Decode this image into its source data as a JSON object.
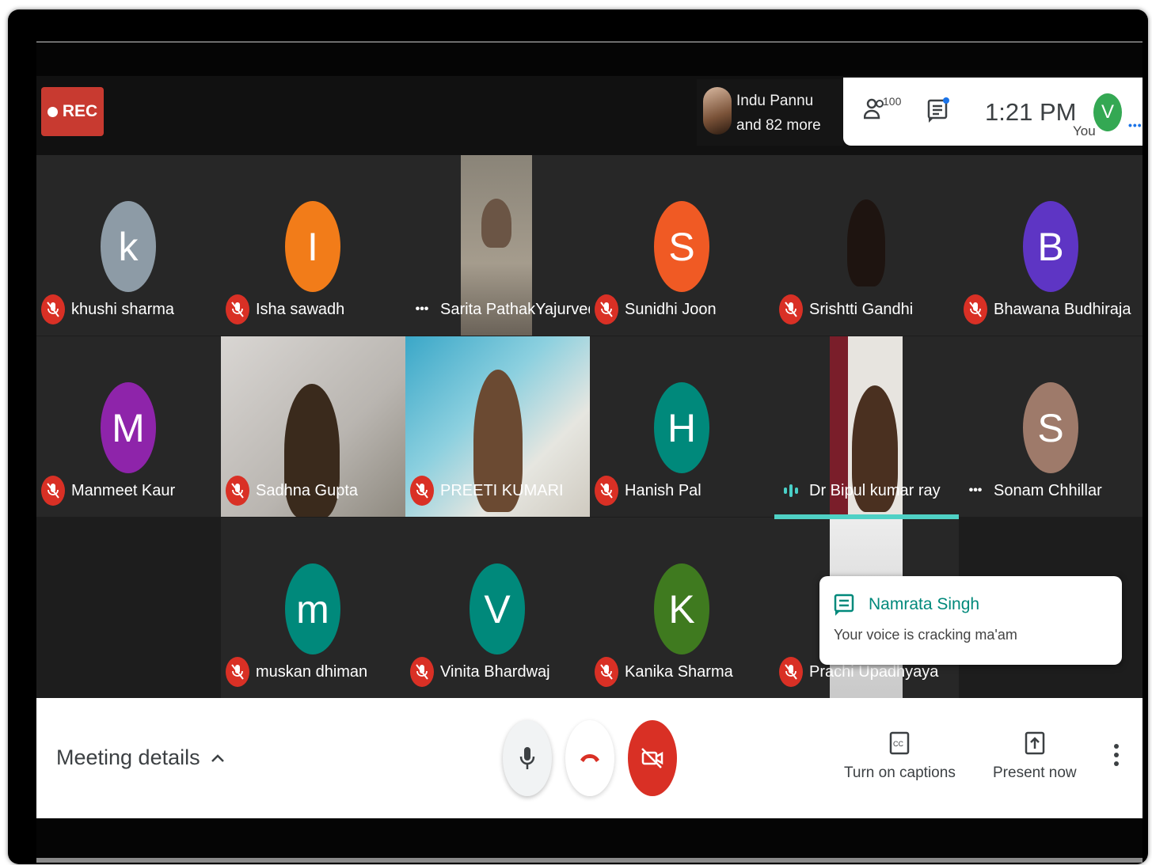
{
  "recording": {
    "label": "REC"
  },
  "host": {
    "line1": "Indu Pannu",
    "line2": "and 82 more"
  },
  "header": {
    "participant_count": "100",
    "time": "1:21 PM",
    "user_initial": "V",
    "user_label": "You"
  },
  "participants": [
    {
      "name": "khushi sharma",
      "initial": "k",
      "color": "#8d9ba6",
      "status": "muted"
    },
    {
      "name": "Isha sawadh",
      "initial": "I",
      "color": "#f27c19",
      "status": "muted"
    },
    {
      "name": "Sarita PathakYajurvedi",
      "initial": "",
      "color": "",
      "status": "more"
    },
    {
      "name": "Sunidhi Joon",
      "initial": "S",
      "color": "#f05a24",
      "status": "muted"
    },
    {
      "name": "Srishtti Gandhi",
      "initial": "",
      "color": "",
      "status": "muted"
    },
    {
      "name": "Bhawana Budhiraja",
      "initial": "B",
      "color": "#5e35c4",
      "status": "muted"
    },
    {
      "name": "Manmeet Kaur",
      "initial": "M",
      "color": "#8e24aa",
      "status": "muted"
    },
    {
      "name": "Sadhna Gupta",
      "initial": "",
      "color": "",
      "status": "muted"
    },
    {
      "name": "PREETI KUMARI",
      "initial": "",
      "color": "",
      "status": "muted"
    },
    {
      "name": "Hanish Pal",
      "initial": "H",
      "color": "#00897b",
      "status": "muted"
    },
    {
      "name": "Dr Bipul kumar ray",
      "initial": "",
      "color": "",
      "status": "speaking"
    },
    {
      "name": "Sonam Chhillar",
      "initial": "S",
      "color": "#9e7a6a",
      "status": "more"
    },
    {
      "name": "muskan dhiman",
      "initial": "m",
      "color": "#00897b",
      "status": "muted"
    },
    {
      "name": "Vinita Bhardwaj",
      "initial": "V",
      "color": "#00897b",
      "status": "muted"
    },
    {
      "name": "Kanika Sharma",
      "initial": "K",
      "color": "#3f7a1f",
      "status": "muted"
    },
    {
      "name": "Prachi Upadhyaya",
      "initial": "",
      "color": "",
      "status": "muted"
    }
  ],
  "chat_notification": {
    "sender": "Namrata Singh",
    "message": "Your voice is cracking ma'am"
  },
  "controls": {
    "meeting_details": "Meeting details",
    "captions": "Turn on captions",
    "present": "Present now"
  },
  "colors": {
    "mute": "#d93025",
    "speaking": "#4fd1c5",
    "end_call": "#d93025"
  }
}
